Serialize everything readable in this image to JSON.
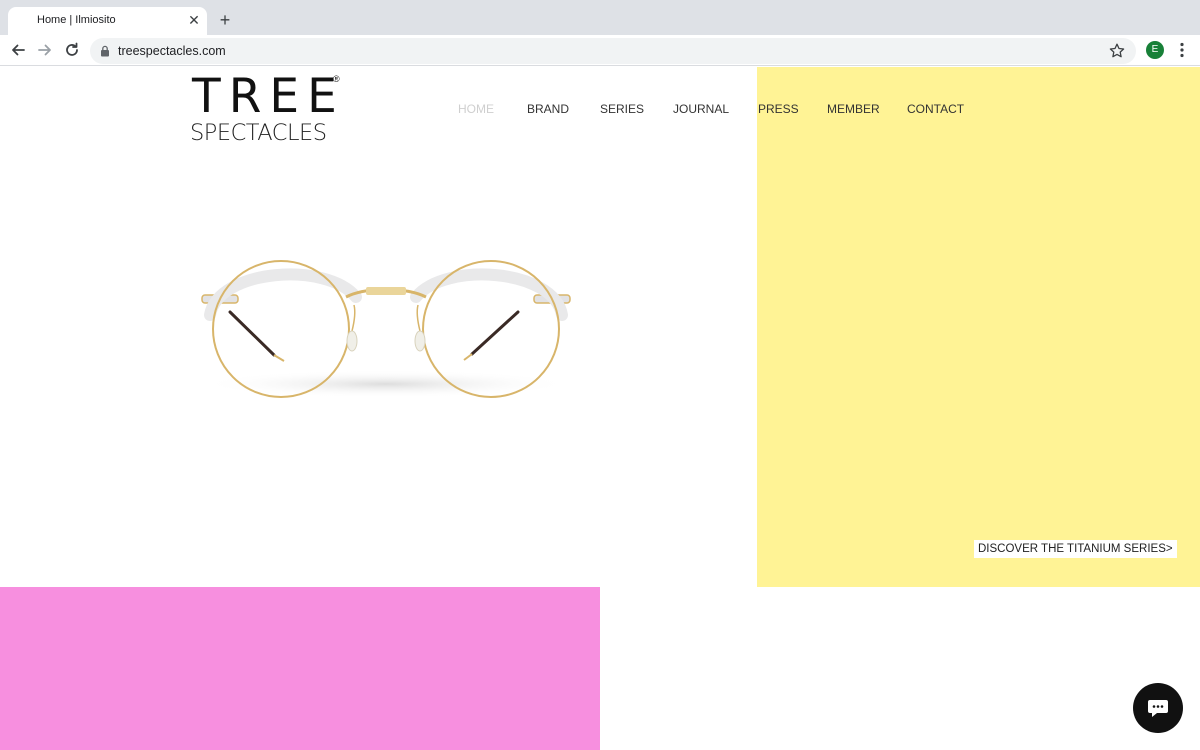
{
  "browser": {
    "tab_title": "Home | Ilmiosito",
    "tab_close": "✕",
    "new_tab": "+",
    "url": "treespectacles.com",
    "profile_initial": "E"
  },
  "site": {
    "logo_top": "TREE",
    "logo_reg": "®",
    "logo_bottom": "SPECTACLES",
    "nav": [
      "HOME",
      "BRAND",
      "SERIES",
      "JOURNAL",
      "PRESS",
      "MEMBER",
      "CONTACT"
    ],
    "active_nav": "HOME",
    "cta_label": "DISCOVER THE TITANIUM SERIES>"
  },
  "colors": {
    "yellow_block": "#fff395",
    "pink_block": "#f78fdf",
    "frame_gold": "#d8b56a",
    "frame_clear": "#e9e9ea",
    "temple_dark": "#3a2a25"
  },
  "icons": {
    "back": "arrow-left-icon",
    "forward": "arrow-right-icon",
    "reload": "reload-icon",
    "lock": "lock-icon",
    "bookmark": "star-icon",
    "menu": "kebab-menu-icon",
    "chat": "chat-icon"
  }
}
